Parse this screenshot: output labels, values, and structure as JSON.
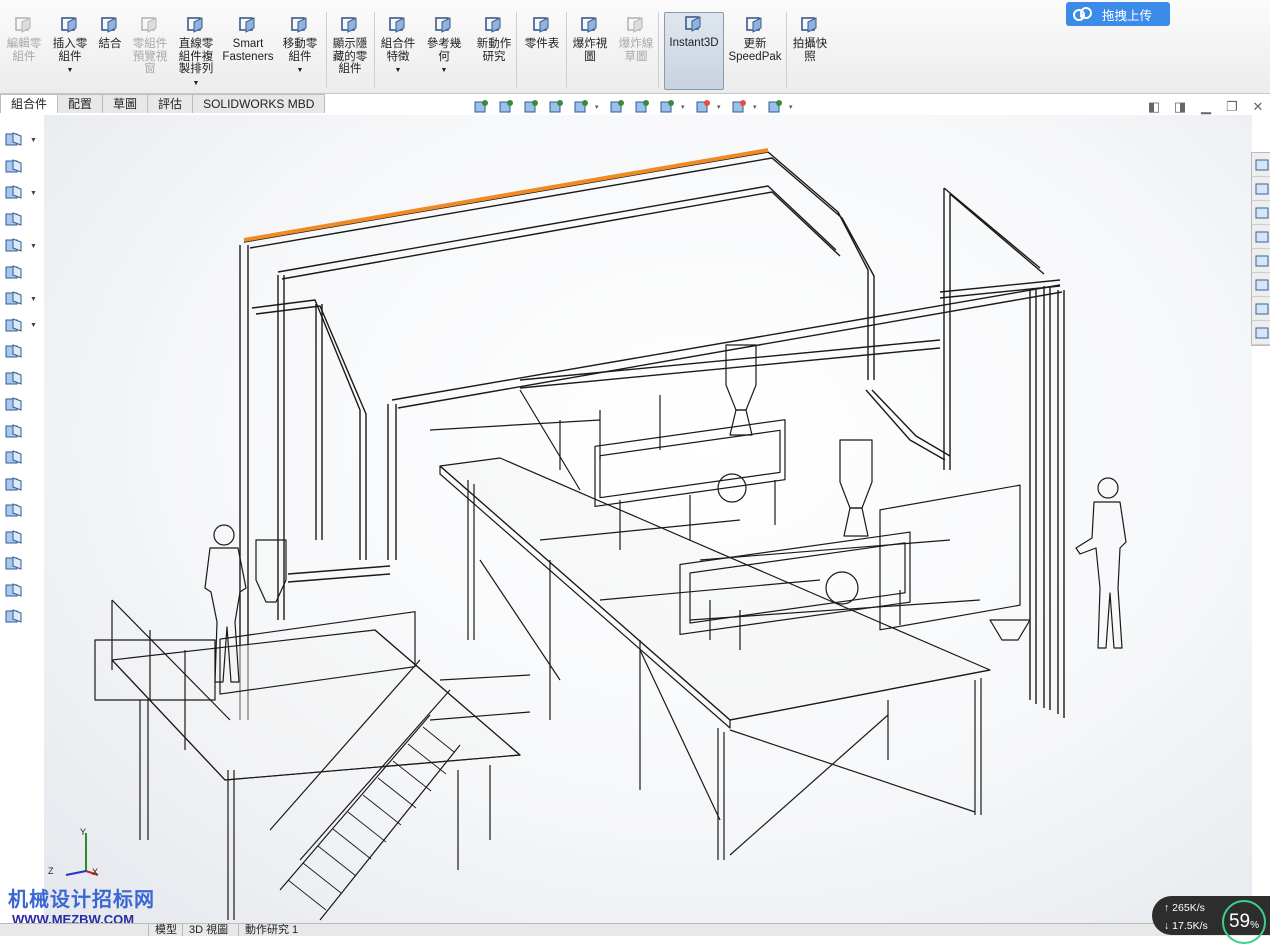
{
  "ribbon": {
    "buttons": [
      {
        "label": "編輯零\n組件",
        "disabled": true,
        "dropdown": false,
        "icon": "edit-component-icon"
      },
      {
        "label": "插入零\n組件",
        "disabled": false,
        "dropdown": true,
        "icon": "insert-component-icon"
      },
      {
        "label": "結合",
        "disabled": false,
        "dropdown": false,
        "icon": "mate-icon"
      },
      {
        "label": "零組件\n預覽視\n窗",
        "disabled": true,
        "dropdown": false,
        "icon": "component-preview-icon"
      },
      {
        "label": "直線零\n組件複\n製排列",
        "disabled": false,
        "dropdown": true,
        "icon": "linear-pattern-icon"
      },
      {
        "label": "Smart\nFasteners",
        "disabled": false,
        "dropdown": false,
        "icon": "smart-fasteners-icon"
      },
      {
        "label": "移動零\n組件",
        "disabled": false,
        "dropdown": true,
        "icon": "move-component-icon"
      },
      {
        "label": "顯示隱\n藏的零\n組件",
        "disabled": false,
        "dropdown": false,
        "icon": "show-hidden-icon"
      },
      {
        "label": "組合件\n特徵",
        "disabled": false,
        "dropdown": true,
        "icon": "assembly-feature-icon"
      },
      {
        "label": "參考幾\n何",
        "disabled": false,
        "dropdown": true,
        "icon": "reference-geometry-icon"
      },
      {
        "label": "新動作\n研究",
        "disabled": false,
        "dropdown": false,
        "icon": "motion-study-icon"
      },
      {
        "label": "零件表",
        "disabled": false,
        "dropdown": false,
        "icon": "bom-icon"
      },
      {
        "label": "爆炸視\n圖",
        "disabled": false,
        "dropdown": false,
        "icon": "exploded-view-icon"
      },
      {
        "label": "爆炸線\n草圖",
        "disabled": true,
        "dropdown": false,
        "icon": "explode-line-icon"
      },
      {
        "label": "Instant3D",
        "disabled": false,
        "dropdown": false,
        "icon": "instant3d-icon",
        "active": true
      },
      {
        "label": "更新\nSpeedPak",
        "disabled": false,
        "dropdown": false,
        "icon": "speedpak-icon"
      },
      {
        "label": "拍攝快\n照",
        "disabled": false,
        "dropdown": false,
        "icon": "snapshot-icon"
      }
    ],
    "cloud_button": "拖拽上传"
  },
  "tabs": [
    "組合件",
    "配置",
    "草圖",
    "評估",
    "SOLIDWORKS MBD"
  ],
  "active_tab": 0,
  "status_tabs": [
    "模型",
    "3D 視圖",
    "動作研究 1"
  ],
  "axis": {
    "x": "X",
    "y": "Y",
    "z": "Z"
  },
  "watermark": {
    "line1": "机械设计招标网",
    "line2": "WWW.MEZBW.COM"
  },
  "netmon": {
    "upload": "265K/s",
    "download": "17.5K/s",
    "percent": "59",
    "percent_unit": "%"
  },
  "colors": {
    "highlight_pipe": "#f08a24",
    "cloud_button": "#3d8be8",
    "accent": "#3bd28a"
  }
}
